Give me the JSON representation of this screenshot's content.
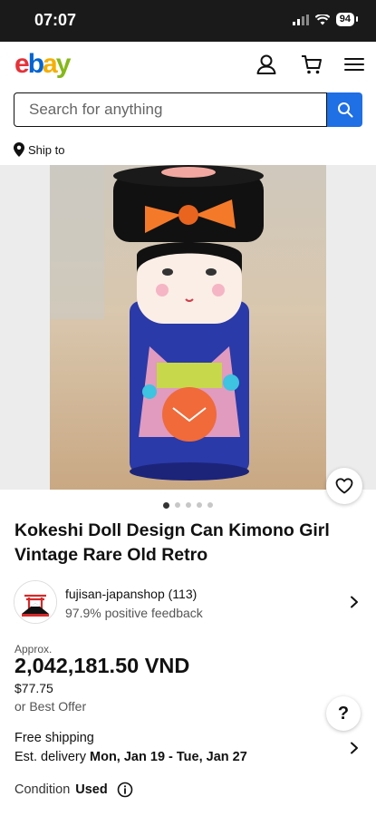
{
  "status": {
    "time": "07:07",
    "battery": "94"
  },
  "header": {
    "logo_letters": [
      "e",
      "b",
      "a",
      "y"
    ],
    "logo_colors": [
      "#e53238",
      "#0064d2",
      "#f5af02",
      "#86b817"
    ]
  },
  "search": {
    "placeholder": "Search for anything"
  },
  "ship_to": {
    "label": "Ship to"
  },
  "gallery": {
    "image_count": 5,
    "active_index": 0
  },
  "listing": {
    "title": "Kokeshi Doll Design Can Kimono Girl Vintage Rare Old Retro",
    "seller": {
      "name": "fujisan-japanshop (113)",
      "feedback": "97.9% positive feedback"
    },
    "approx_label": "Approx.",
    "price": "2,042,181.50 VND",
    "price_usd": "$77.75",
    "offer": "or Best Offer",
    "shipping": "Free shipping",
    "delivery_label": "Est. delivery",
    "delivery_dates": "Mon, Jan 19 - Tue, Jan 27",
    "condition_label": "Condition",
    "condition_value": "Used"
  },
  "help": {
    "label": "?"
  }
}
